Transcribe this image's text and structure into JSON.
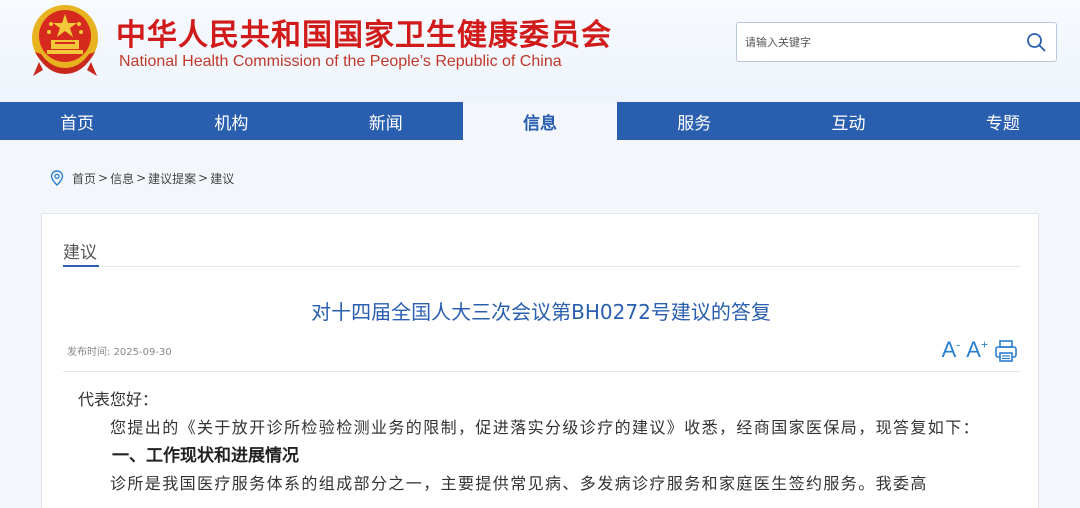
{
  "header": {
    "title_cn": "中华人民共和国国家卫生健康委员会",
    "title_en": "National Health Commission of the People’s  Republic of China",
    "search_placeholder": "请输入关键字"
  },
  "nav": {
    "items": [
      {
        "label": "首页"
      },
      {
        "label": "机构"
      },
      {
        "label": "新闻"
      },
      {
        "label": "信息"
      },
      {
        "label": "服务"
      },
      {
        "label": "互动"
      },
      {
        "label": "专题"
      }
    ],
    "active_index": 3
  },
  "breadcrumb": {
    "items": [
      "首页",
      "信息",
      "建议提案",
      "建议"
    ],
    "separator": ">"
  },
  "section": {
    "title": "建议"
  },
  "article": {
    "title": "对十四届全国人大三次会议第BH0272号建议的答复",
    "publish_label": "发布时间:",
    "publish_date": "2025-09-30",
    "font_decrease": "A",
    "font_increase": "A",
    "greeting": "代表您好：",
    "paragraph1": "您提出的《关于放开诊所检验检测业务的限制，促进落实分级诊疗的建议》收悉，经商国家医保局，现答复如下：",
    "heading1": "一、工作现状和进展情况",
    "paragraph2": "诊所是我国医疗服务体系的组成部分之一，主要提供常见病、多发病诊疗服务和家庭医生签约服务。我委高"
  },
  "colors": {
    "brand_red": "#d11a1a",
    "nav_blue": "#2a5fb0",
    "title_blue": "#2a5fb0"
  }
}
